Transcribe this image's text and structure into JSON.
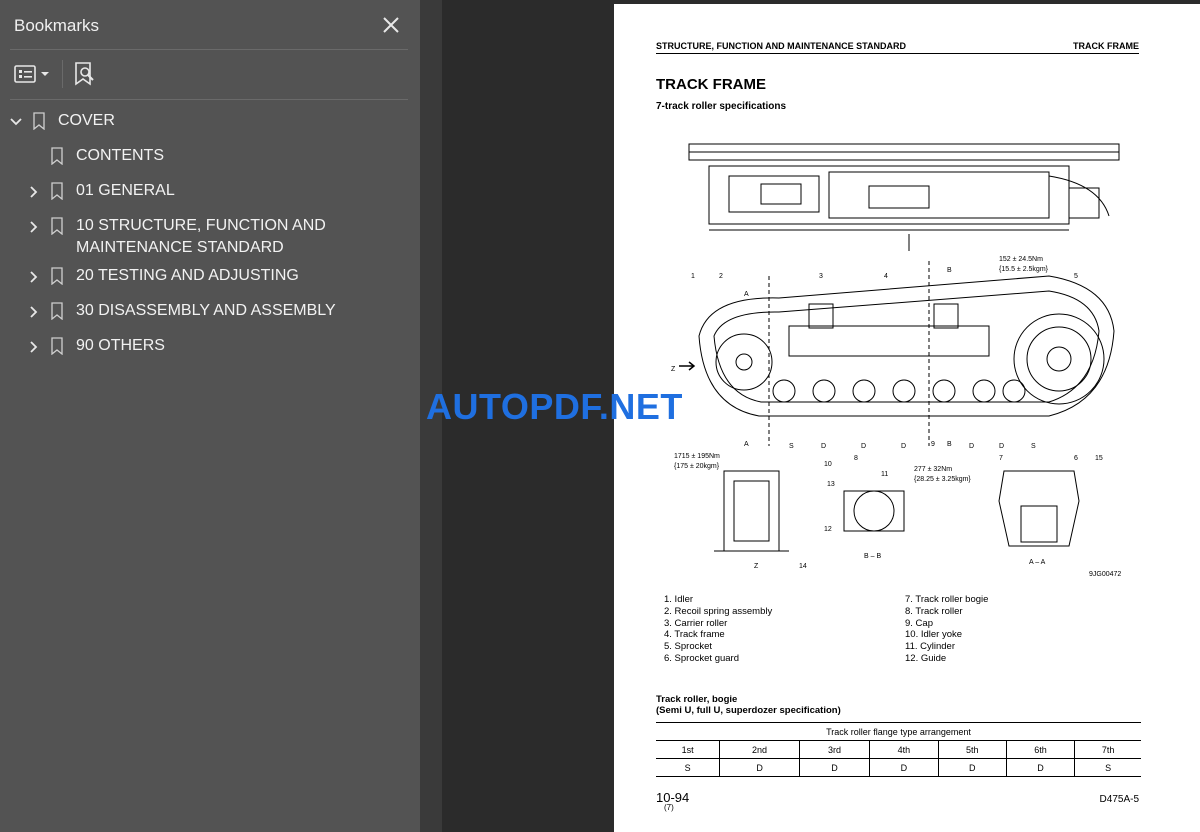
{
  "sidebar": {
    "title": "Bookmarks",
    "items": [
      {
        "label": "COVER",
        "expanded": true
      },
      {
        "label": "CONTENTS"
      },
      {
        "label": "01 GENERAL"
      },
      {
        "label": "10 STRUCTURE, FUNCTION AND MAINTENANCE STANDARD"
      },
      {
        "label": "20 TESTING AND ADJUSTING"
      },
      {
        "label": "30 DISASSEMBLY AND ASSEMBLY"
      },
      {
        "label": "90 OTHERS"
      }
    ]
  },
  "watermark": "AUTOPDF.NET",
  "doc": {
    "header_left": "STRUCTURE, FUNCTION AND MAINTENANCE STANDARD",
    "header_right": "TRACK FRAME",
    "title": "TRACK FRAME",
    "subtitle": "7-track roller specifications",
    "figure": {
      "torque1": "152 ± 24.5Nm",
      "torque1b": "{15.5 ± 2.5kgm}",
      "torque2": "1715 ± 195Nm",
      "torque2b": "{175 ± 20kgm}",
      "torque3": "277 ± 32Nm",
      "torque3b": "{28.25 ± 3.25kgm}",
      "section_a": "A",
      "section_b": "B",
      "arrow_z": "Z",
      "view_bb": "B – B",
      "view_aa": "A – A",
      "view_z": "Z",
      "fig_code": "9JG00472",
      "callouts": [
        "1",
        "2",
        "3",
        "4",
        "5",
        "6",
        "7",
        "8",
        "9",
        "10",
        "11",
        "12",
        "13",
        "14",
        "15"
      ],
      "flange_marks": [
        "S",
        "D",
        "D",
        "D",
        "D",
        "D",
        "S"
      ]
    },
    "legend_left": [
      "1. Idler",
      "2. Recoil spring assembly",
      "3. Carrier roller",
      "4. Track frame",
      "5. Sprocket",
      "6. Sprocket guard"
    ],
    "legend_right": [
      "7. Track roller bogie",
      "8. Track roller",
      "9. Cap",
      "10. Idler yoke",
      "11. Cylinder",
      "12. Guide"
    ],
    "bogie_title": "Track roller, bogie",
    "bogie_sub": "(Semi U, full U, superdozer specification)",
    "table": {
      "caption": "Track roller flange type arrangement",
      "headers": [
        "1st",
        "2nd",
        "3rd",
        "4th",
        "5th",
        "6th",
        "7th"
      ],
      "values": [
        "S",
        "D",
        "D",
        "D",
        "D",
        "D",
        "S"
      ]
    },
    "page_number": "10-94",
    "page_sub": "(7)",
    "model": "D475A-5"
  }
}
